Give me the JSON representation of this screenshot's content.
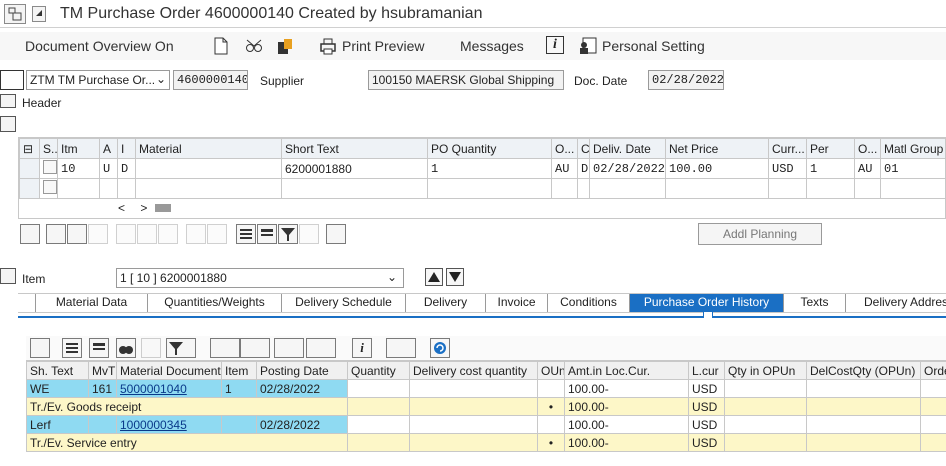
{
  "window": {
    "title": "TM Purchase Order 4600000140 Created by hsubramanian"
  },
  "appbar": {
    "doc_overview": "Document Overview On",
    "print_preview": "Print Preview",
    "messages": "Messages",
    "personal_setting": "Personal Setting"
  },
  "header": {
    "doc_type": "ZTM TM Purchase Or...",
    "po_number": "4600000140",
    "supplier_label": "Supplier",
    "supplier": "100150 MAERSK Global Shipping",
    "docdate_label": "Doc. Date",
    "docdate": "02/28/2022",
    "header_label": "Header"
  },
  "items": {
    "columns": [
      "S..",
      "Itm",
      "A",
      "I",
      "Material",
      "Short Text",
      "PO Quantity",
      "O...",
      "C",
      "Deliv. Date",
      "Net Price",
      "Curr...",
      "Per",
      "O...",
      "Matl Group"
    ],
    "row": {
      "itm": "10",
      "a": "U",
      "i": "D",
      "material": "",
      "short_text": "6200001880",
      "qty": "1",
      "ou": "AU",
      "c": "D",
      "deliv": "02/28/2022",
      "price": "100.00",
      "curr": "USD",
      "per": "1",
      "opu": "AU",
      "mg": "01"
    },
    "scroll": "< >",
    "addl_planning": "Addl Planning"
  },
  "item_detail": {
    "label": "Item",
    "value": "1 [ 10 ] 6200001880",
    "tabs": [
      "Material Data",
      "Quantities/Weights",
      "Delivery Schedule",
      "Delivery",
      "Invoice",
      "Conditions",
      "Purchase Order History",
      "Texts",
      "Delivery Address"
    ],
    "active_tab": "Purchase Order History"
  },
  "history": {
    "columns": [
      "Sh. Text",
      "MvT",
      "Material Document",
      "Item",
      "Posting Date",
      "Quantity",
      "Delivery cost quantity",
      "OUn",
      "Amt.in Loc.Cur.",
      "L.cur",
      "Qty in OPUn",
      "DelCostQty (OPUn)",
      "Order Pri"
    ],
    "rows": [
      {
        "sh": "WE",
        "mvt": "161",
        "doc": "5000001040",
        "item": "1",
        "date": "02/28/2022",
        "amt": "100.00-",
        "cur": "USD"
      },
      {
        "total": "Tr./Ev. Goods receipt",
        "dot": "•",
        "amt": "100.00-",
        "cur": "USD"
      },
      {
        "sh": "Lerf",
        "mvt": "",
        "doc": "1000000345",
        "item": "",
        "date": "02/28/2022",
        "amt": "100.00-",
        "cur": "USD"
      },
      {
        "total": "Tr./Ev. Service entry",
        "dot": "•",
        "amt": "100.00-",
        "cur": "USD"
      }
    ]
  },
  "colors": {
    "accent": "#1a6fc4",
    "highlight": "#8fdaf2",
    "total_row": "#fdf7c8"
  }
}
